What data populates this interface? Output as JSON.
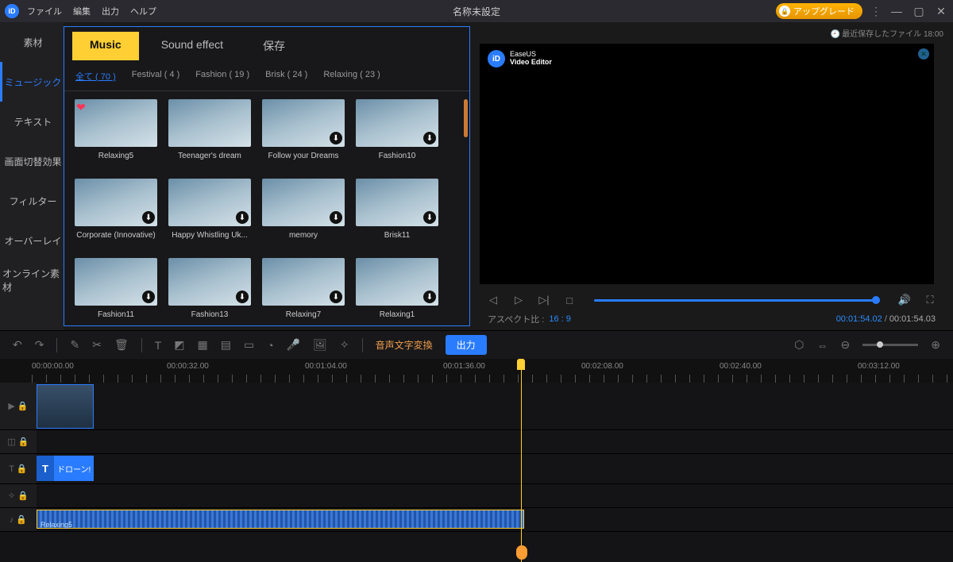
{
  "titlebar": {
    "menus": [
      "ファイル",
      "編集",
      "出力",
      "ヘルプ"
    ],
    "title": "名称未設定",
    "upgrade": "アップグレード"
  },
  "recent_line": "最近保存したファイル 18:00",
  "vtabs": [
    "素材",
    "ミュージック",
    "テキスト",
    "画面切替効果",
    "フィルター",
    "オーバーレイ",
    "オンライン素材"
  ],
  "vtab_active_index": 1,
  "lib": {
    "tabs": [
      "Music",
      "Sound effect",
      "保存"
    ],
    "active_tab": 0,
    "filters": [
      {
        "label": "全て ( 70 )",
        "active": true
      },
      {
        "label": "Festival ( 4 )"
      },
      {
        "label": "Fashion ( 19 )"
      },
      {
        "label": "Brisk ( 24 )"
      },
      {
        "label": "Relaxing ( 23 )"
      }
    ],
    "items": [
      {
        "label": "Relaxing5",
        "heart": true
      },
      {
        "label": "Teenager's dream"
      },
      {
        "label": "Follow your Dreams"
      },
      {
        "label": "Fashion10"
      },
      {
        "label": "Corporate (Innovative)"
      },
      {
        "label": "Happy Whistling Uk..."
      },
      {
        "label": "memory"
      },
      {
        "label": "Brisk11"
      },
      {
        "label": "Fashion11"
      },
      {
        "label": "Fashion13"
      },
      {
        "label": "Relaxing7"
      },
      {
        "label": "Relaxing1"
      }
    ]
  },
  "preview": {
    "brand_top": "EaseUS",
    "brand_bottom": "Video Editor",
    "aspect_label": "アスペクト比 :",
    "aspect_value": "16 : 9",
    "time_cur": "00:01:54.02",
    "time_sep": "/",
    "time_tot": "00:01:54.03"
  },
  "toolbar": {
    "speech_btn": "音声文字変換",
    "export_btn": "出力"
  },
  "ruler": {
    "labels": [
      "00:00:00.00",
      "00:00:32.00",
      "00:01:04.00",
      "00:01:36.00",
      "00:02:08.00",
      "00:02:40.00",
      "00:03:12.00"
    ],
    "positions": [
      46,
      216,
      390,
      564,
      738,
      912,
      1086
    ]
  },
  "tracks": {
    "text_clip": "ドローン!",
    "audio_clip": "Relaxing5"
  }
}
